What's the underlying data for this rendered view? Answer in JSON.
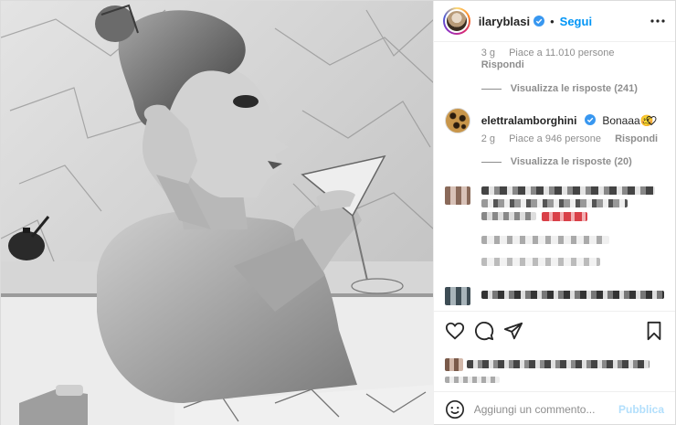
{
  "post": {
    "author": "ilaryblasi",
    "follow_label": "Segui",
    "dot": "•"
  },
  "comments": [
    {
      "time": "3 g",
      "likes": "Piace a 11.010 persone",
      "reply": "Rispondi",
      "view_replies": "Visualizza le risposte (241)"
    },
    {
      "user": "elettralamborghini",
      "text": "Bonaaa🥴",
      "time": "2 g",
      "likes": "Piace a 946 persone",
      "reply": "Rispondi",
      "view_replies": "Visualizza le risposte (20)"
    }
  ],
  "add_comment": {
    "placeholder": "Aggiungi un commento...",
    "publish_label": "Pubblica"
  },
  "colors": {
    "link_blue": "#0095f6",
    "publish_disabled": "#b2dffc",
    "secondary_text": "#8e8e8e"
  },
  "icons": [
    "verified-badge-icon",
    "more-options-icon",
    "heart-icon",
    "comment-icon",
    "share-icon",
    "bookmark-icon",
    "emoji-icon"
  ]
}
